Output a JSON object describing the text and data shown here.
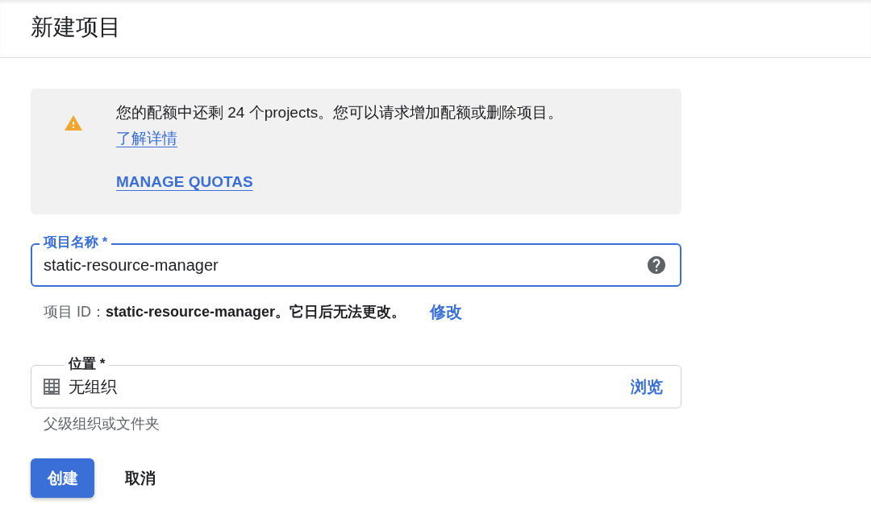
{
  "header": {
    "title": "新建项目"
  },
  "notice": {
    "kind": "warning",
    "message": "您的配额中还剩 24 个projects。您可以请求增加配额或删除项目。",
    "link": "了解详情",
    "action": "MANAGE QUOTAS"
  },
  "fields": [
    {
      "kind": "text",
      "label": "项目名称 *",
      "value": "static-resource-manager",
      "focused": true,
      "hint": "项目 ID：**static-resource-manager。它日后无法更改。**",
      "hint_link": "修改"
    },
    {
      "kind": "picker",
      "label": "位置 *",
      "value": "无组织",
      "focused": false,
      "action": "浏览",
      "hint": "父级组织或文件夹"
    }
  ],
  "buttons": [
    {
      "label": "创建",
      "kind": "primary"
    },
    {
      "label": "取消",
      "kind": "text"
    }
  ]
}
